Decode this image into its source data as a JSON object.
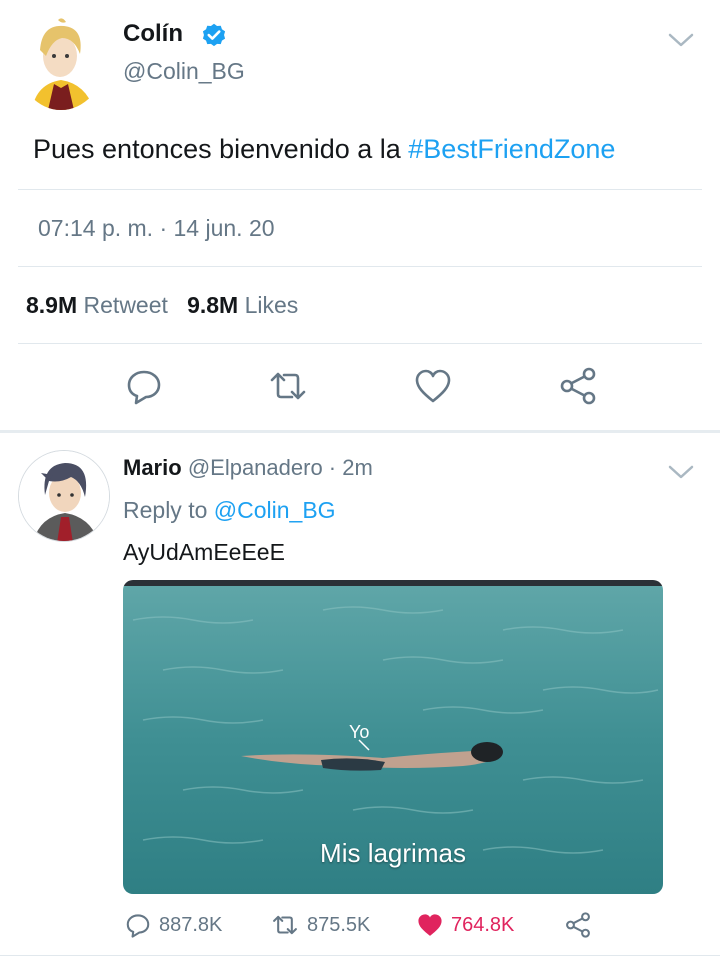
{
  "main_tweet": {
    "author_name": "Colín",
    "author_handle": "@Colin_BG",
    "text_prefix": "Pues entonces bienvenido a la ",
    "hashtag": "#BestFriendZone",
    "timestamp": "07:14 p. m. · 14 jun. 20",
    "retweet_count": "8.9M",
    "retweet_label": "Retweet",
    "like_count": "9.8M",
    "like_label": "Likes",
    "actions": [
      "reply-icon",
      "retweet-icon",
      "like-icon",
      "share-icon"
    ]
  },
  "reply": {
    "author_name": "Mario",
    "meta": "@Elpanadero · 2m",
    "reply_to_prefix": "Reply to ",
    "reply_to_mention": "@Colin_BG",
    "text": "AyUdAmEeEeE",
    "media": {
      "label": "Yo",
      "caption": "Mis lagrimas"
    },
    "reply_count": "887.8K",
    "retweet_count": "875.5K",
    "like_count": "764.8K"
  },
  "colors": {
    "accent": "#1da1f2",
    "secondary_text": "#657786",
    "like_red": "#e0245e",
    "divider": "#e1e8ed"
  }
}
